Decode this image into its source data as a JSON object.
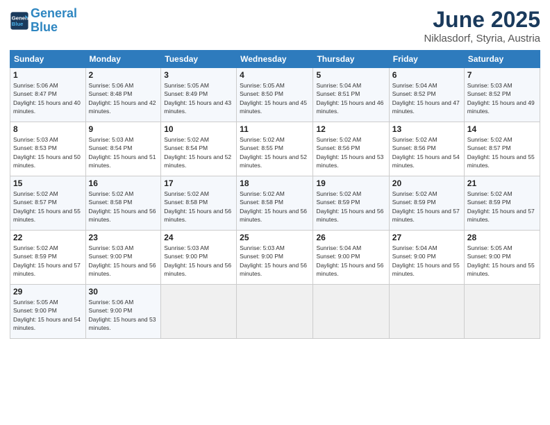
{
  "header": {
    "logo_line1": "General",
    "logo_line2": "Blue",
    "month": "June 2025",
    "location": "Niklasdorf, Styria, Austria"
  },
  "weekdays": [
    "Sunday",
    "Monday",
    "Tuesday",
    "Wednesday",
    "Thursday",
    "Friday",
    "Saturday"
  ],
  "weeks": [
    [
      {
        "day": "1",
        "sunrise": "5:06 AM",
        "sunset": "8:47 PM",
        "daylight": "15 hours and 40 minutes."
      },
      {
        "day": "2",
        "sunrise": "5:06 AM",
        "sunset": "8:48 PM",
        "daylight": "15 hours and 42 minutes."
      },
      {
        "day": "3",
        "sunrise": "5:05 AM",
        "sunset": "8:49 PM",
        "daylight": "15 hours and 43 minutes."
      },
      {
        "day": "4",
        "sunrise": "5:05 AM",
        "sunset": "8:50 PM",
        "daylight": "15 hours and 45 minutes."
      },
      {
        "day": "5",
        "sunrise": "5:04 AM",
        "sunset": "8:51 PM",
        "daylight": "15 hours and 46 minutes."
      },
      {
        "day": "6",
        "sunrise": "5:04 AM",
        "sunset": "8:52 PM",
        "daylight": "15 hours and 47 minutes."
      },
      {
        "day": "7",
        "sunrise": "5:03 AM",
        "sunset": "8:52 PM",
        "daylight": "15 hours and 49 minutes."
      }
    ],
    [
      {
        "day": "8",
        "sunrise": "5:03 AM",
        "sunset": "8:53 PM",
        "daylight": "15 hours and 50 minutes."
      },
      {
        "day": "9",
        "sunrise": "5:03 AM",
        "sunset": "8:54 PM",
        "daylight": "15 hours and 51 minutes."
      },
      {
        "day": "10",
        "sunrise": "5:02 AM",
        "sunset": "8:54 PM",
        "daylight": "15 hours and 52 minutes."
      },
      {
        "day": "11",
        "sunrise": "5:02 AM",
        "sunset": "8:55 PM",
        "daylight": "15 hours and 52 minutes."
      },
      {
        "day": "12",
        "sunrise": "5:02 AM",
        "sunset": "8:56 PM",
        "daylight": "15 hours and 53 minutes."
      },
      {
        "day": "13",
        "sunrise": "5:02 AM",
        "sunset": "8:56 PM",
        "daylight": "15 hours and 54 minutes."
      },
      {
        "day": "14",
        "sunrise": "5:02 AM",
        "sunset": "8:57 PM",
        "daylight": "15 hours and 55 minutes."
      }
    ],
    [
      {
        "day": "15",
        "sunrise": "5:02 AM",
        "sunset": "8:57 PM",
        "daylight": "15 hours and 55 minutes."
      },
      {
        "day": "16",
        "sunrise": "5:02 AM",
        "sunset": "8:58 PM",
        "daylight": "15 hours and 56 minutes."
      },
      {
        "day": "17",
        "sunrise": "5:02 AM",
        "sunset": "8:58 PM",
        "daylight": "15 hours and 56 minutes."
      },
      {
        "day": "18",
        "sunrise": "5:02 AM",
        "sunset": "8:58 PM",
        "daylight": "15 hours and 56 minutes."
      },
      {
        "day": "19",
        "sunrise": "5:02 AM",
        "sunset": "8:59 PM",
        "daylight": "15 hours and 56 minutes."
      },
      {
        "day": "20",
        "sunrise": "5:02 AM",
        "sunset": "8:59 PM",
        "daylight": "15 hours and 57 minutes."
      },
      {
        "day": "21",
        "sunrise": "5:02 AM",
        "sunset": "8:59 PM",
        "daylight": "15 hours and 57 minutes."
      }
    ],
    [
      {
        "day": "22",
        "sunrise": "5:02 AM",
        "sunset": "8:59 PM",
        "daylight": "15 hours and 57 minutes."
      },
      {
        "day": "23",
        "sunrise": "5:03 AM",
        "sunset": "9:00 PM",
        "daylight": "15 hours and 56 minutes."
      },
      {
        "day": "24",
        "sunrise": "5:03 AM",
        "sunset": "9:00 PM",
        "daylight": "15 hours and 56 minutes."
      },
      {
        "day": "25",
        "sunrise": "5:03 AM",
        "sunset": "9:00 PM",
        "daylight": "15 hours and 56 minutes."
      },
      {
        "day": "26",
        "sunrise": "5:04 AM",
        "sunset": "9:00 PM",
        "daylight": "15 hours and 56 minutes."
      },
      {
        "day": "27",
        "sunrise": "5:04 AM",
        "sunset": "9:00 PM",
        "daylight": "15 hours and 55 minutes."
      },
      {
        "day": "28",
        "sunrise": "5:05 AM",
        "sunset": "9:00 PM",
        "daylight": "15 hours and 55 minutes."
      }
    ],
    [
      {
        "day": "29",
        "sunrise": "5:05 AM",
        "sunset": "9:00 PM",
        "daylight": "15 hours and 54 minutes."
      },
      {
        "day": "30",
        "sunrise": "5:06 AM",
        "sunset": "9:00 PM",
        "daylight": "15 hours and 53 minutes."
      },
      null,
      null,
      null,
      null,
      null
    ]
  ]
}
